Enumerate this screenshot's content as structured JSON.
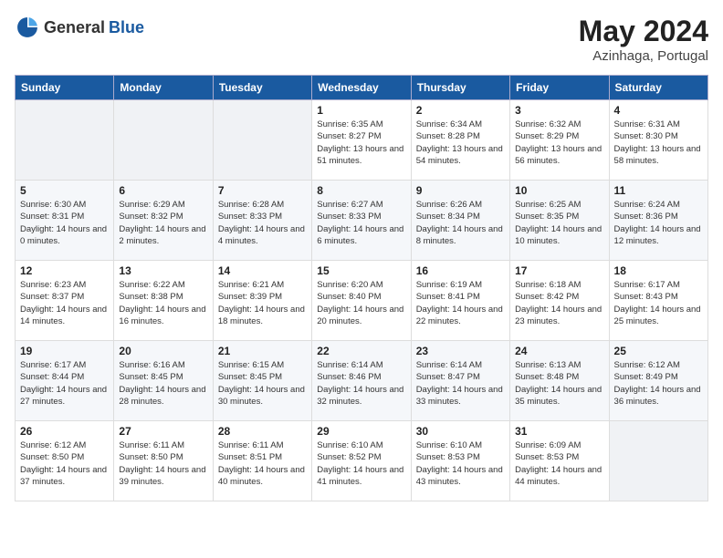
{
  "header": {
    "logo_general": "General",
    "logo_blue": "Blue",
    "month_year": "May 2024",
    "location": "Azinhaga, Portugal"
  },
  "days_of_week": [
    "Sunday",
    "Monday",
    "Tuesday",
    "Wednesday",
    "Thursday",
    "Friday",
    "Saturday"
  ],
  "weeks": [
    [
      {
        "day": "",
        "empty": true
      },
      {
        "day": "",
        "empty": true
      },
      {
        "day": "",
        "empty": true
      },
      {
        "day": "1",
        "sunrise": "Sunrise: 6:35 AM",
        "sunset": "Sunset: 8:27 PM",
        "daylight": "Daylight: 13 hours and 51 minutes."
      },
      {
        "day": "2",
        "sunrise": "Sunrise: 6:34 AM",
        "sunset": "Sunset: 8:28 PM",
        "daylight": "Daylight: 13 hours and 54 minutes."
      },
      {
        "day": "3",
        "sunrise": "Sunrise: 6:32 AM",
        "sunset": "Sunset: 8:29 PM",
        "daylight": "Daylight: 13 hours and 56 minutes."
      },
      {
        "day": "4",
        "sunrise": "Sunrise: 6:31 AM",
        "sunset": "Sunset: 8:30 PM",
        "daylight": "Daylight: 13 hours and 58 minutes."
      }
    ],
    [
      {
        "day": "5",
        "sunrise": "Sunrise: 6:30 AM",
        "sunset": "Sunset: 8:31 PM",
        "daylight": "Daylight: 14 hours and 0 minutes."
      },
      {
        "day": "6",
        "sunrise": "Sunrise: 6:29 AM",
        "sunset": "Sunset: 8:32 PM",
        "daylight": "Daylight: 14 hours and 2 minutes."
      },
      {
        "day": "7",
        "sunrise": "Sunrise: 6:28 AM",
        "sunset": "Sunset: 8:33 PM",
        "daylight": "Daylight: 14 hours and 4 minutes."
      },
      {
        "day": "8",
        "sunrise": "Sunrise: 6:27 AM",
        "sunset": "Sunset: 8:33 PM",
        "daylight": "Daylight: 14 hours and 6 minutes."
      },
      {
        "day": "9",
        "sunrise": "Sunrise: 6:26 AM",
        "sunset": "Sunset: 8:34 PM",
        "daylight": "Daylight: 14 hours and 8 minutes."
      },
      {
        "day": "10",
        "sunrise": "Sunrise: 6:25 AM",
        "sunset": "Sunset: 8:35 PM",
        "daylight": "Daylight: 14 hours and 10 minutes."
      },
      {
        "day": "11",
        "sunrise": "Sunrise: 6:24 AM",
        "sunset": "Sunset: 8:36 PM",
        "daylight": "Daylight: 14 hours and 12 minutes."
      }
    ],
    [
      {
        "day": "12",
        "sunrise": "Sunrise: 6:23 AM",
        "sunset": "Sunset: 8:37 PM",
        "daylight": "Daylight: 14 hours and 14 minutes."
      },
      {
        "day": "13",
        "sunrise": "Sunrise: 6:22 AM",
        "sunset": "Sunset: 8:38 PM",
        "daylight": "Daylight: 14 hours and 16 minutes."
      },
      {
        "day": "14",
        "sunrise": "Sunrise: 6:21 AM",
        "sunset": "Sunset: 8:39 PM",
        "daylight": "Daylight: 14 hours and 18 minutes."
      },
      {
        "day": "15",
        "sunrise": "Sunrise: 6:20 AM",
        "sunset": "Sunset: 8:40 PM",
        "daylight": "Daylight: 14 hours and 20 minutes."
      },
      {
        "day": "16",
        "sunrise": "Sunrise: 6:19 AM",
        "sunset": "Sunset: 8:41 PM",
        "daylight": "Daylight: 14 hours and 22 minutes."
      },
      {
        "day": "17",
        "sunrise": "Sunrise: 6:18 AM",
        "sunset": "Sunset: 8:42 PM",
        "daylight": "Daylight: 14 hours and 23 minutes."
      },
      {
        "day": "18",
        "sunrise": "Sunrise: 6:17 AM",
        "sunset": "Sunset: 8:43 PM",
        "daylight": "Daylight: 14 hours and 25 minutes."
      }
    ],
    [
      {
        "day": "19",
        "sunrise": "Sunrise: 6:17 AM",
        "sunset": "Sunset: 8:44 PM",
        "daylight": "Daylight: 14 hours and 27 minutes."
      },
      {
        "day": "20",
        "sunrise": "Sunrise: 6:16 AM",
        "sunset": "Sunset: 8:45 PM",
        "daylight": "Daylight: 14 hours and 28 minutes."
      },
      {
        "day": "21",
        "sunrise": "Sunrise: 6:15 AM",
        "sunset": "Sunset: 8:45 PM",
        "daylight": "Daylight: 14 hours and 30 minutes."
      },
      {
        "day": "22",
        "sunrise": "Sunrise: 6:14 AM",
        "sunset": "Sunset: 8:46 PM",
        "daylight": "Daylight: 14 hours and 32 minutes."
      },
      {
        "day": "23",
        "sunrise": "Sunrise: 6:14 AM",
        "sunset": "Sunset: 8:47 PM",
        "daylight": "Daylight: 14 hours and 33 minutes."
      },
      {
        "day": "24",
        "sunrise": "Sunrise: 6:13 AM",
        "sunset": "Sunset: 8:48 PM",
        "daylight": "Daylight: 14 hours and 35 minutes."
      },
      {
        "day": "25",
        "sunrise": "Sunrise: 6:12 AM",
        "sunset": "Sunset: 8:49 PM",
        "daylight": "Daylight: 14 hours and 36 minutes."
      }
    ],
    [
      {
        "day": "26",
        "sunrise": "Sunrise: 6:12 AM",
        "sunset": "Sunset: 8:50 PM",
        "daylight": "Daylight: 14 hours and 37 minutes."
      },
      {
        "day": "27",
        "sunrise": "Sunrise: 6:11 AM",
        "sunset": "Sunset: 8:50 PM",
        "daylight": "Daylight: 14 hours and 39 minutes."
      },
      {
        "day": "28",
        "sunrise": "Sunrise: 6:11 AM",
        "sunset": "Sunset: 8:51 PM",
        "daylight": "Daylight: 14 hours and 40 minutes."
      },
      {
        "day": "29",
        "sunrise": "Sunrise: 6:10 AM",
        "sunset": "Sunset: 8:52 PM",
        "daylight": "Daylight: 14 hours and 41 minutes."
      },
      {
        "day": "30",
        "sunrise": "Sunrise: 6:10 AM",
        "sunset": "Sunset: 8:53 PM",
        "daylight": "Daylight: 14 hours and 43 minutes."
      },
      {
        "day": "31",
        "sunrise": "Sunrise: 6:09 AM",
        "sunset": "Sunset: 8:53 PM",
        "daylight": "Daylight: 14 hours and 44 minutes."
      },
      {
        "day": "",
        "empty": true
      }
    ]
  ]
}
